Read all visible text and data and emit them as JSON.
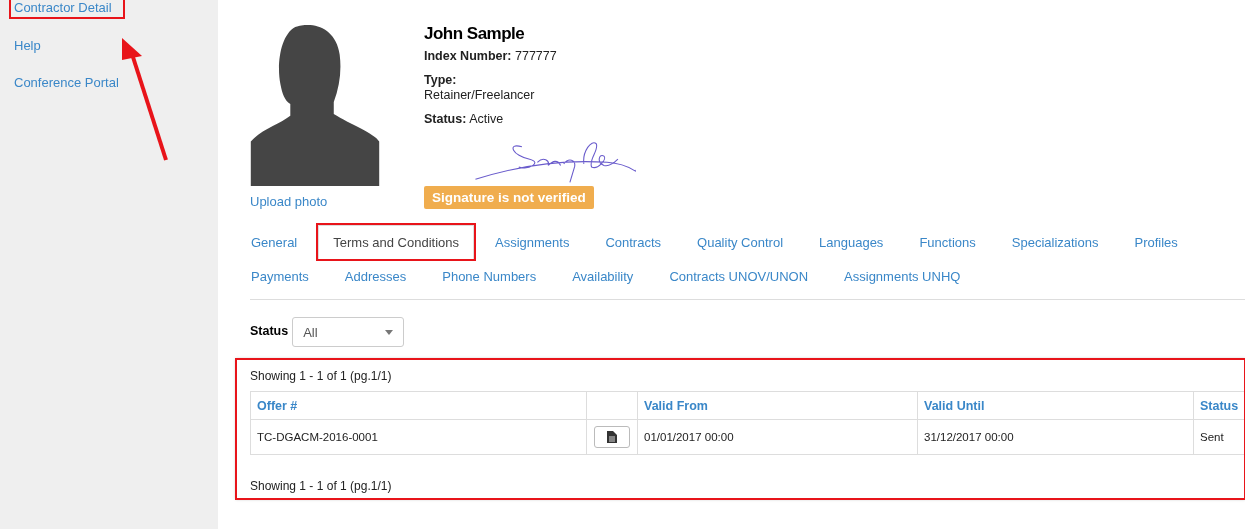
{
  "sidebar": {
    "items": [
      {
        "label": "Contractor Detail",
        "highlighted": true
      },
      {
        "label": "Help",
        "highlighted": false
      },
      {
        "label": "Conference Portal",
        "highlighted": false
      }
    ]
  },
  "profile": {
    "name": "John Sample",
    "upload_link": "Upload photo",
    "fields": [
      {
        "label": "Index Number:",
        "value": "777777",
        "stacked": false
      },
      {
        "label": "Type:",
        "value": "Retainer/Freelancer",
        "stacked": true
      },
      {
        "label": "Status:",
        "value": "Active",
        "stacked": false
      }
    ],
    "signature_badge": "Signature is not verified"
  },
  "tabs": [
    {
      "label": "General",
      "selected": false,
      "highlighted": false
    },
    {
      "label": "Terms and Conditions",
      "selected": true,
      "highlighted": true
    },
    {
      "label": "Assignments",
      "selected": false,
      "highlighted": false
    },
    {
      "label": "Contracts",
      "selected": false,
      "highlighted": false
    },
    {
      "label": "Quality Control",
      "selected": false,
      "highlighted": false
    },
    {
      "label": "Languages",
      "selected": false,
      "highlighted": false
    },
    {
      "label": "Functions",
      "selected": false,
      "highlighted": false
    },
    {
      "label": "Specializations",
      "selected": false,
      "highlighted": false
    },
    {
      "label": "Profiles",
      "selected": false,
      "highlighted": false
    },
    {
      "label": "Payments",
      "selected": false,
      "highlighted": false
    },
    {
      "label": "Addresses",
      "selected": false,
      "highlighted": false
    },
    {
      "label": "Phone Numbers",
      "selected": false,
      "highlighted": false
    },
    {
      "label": "Availability",
      "selected": false,
      "highlighted": false
    },
    {
      "label": "Contracts UNOV/UNON",
      "selected": false,
      "highlighted": false
    },
    {
      "label": "Assignments UNHQ",
      "selected": false,
      "highlighted": false
    }
  ],
  "filter": {
    "label": "Status",
    "value": "All"
  },
  "table": {
    "highlighted": true,
    "summary_top": "Showing 1 - 1 of 1 (pg.1/1)",
    "summary_bottom": "Showing 1 - 1 of 1 (pg.1/1)",
    "columns": [
      "Offer #",
      "",
      "Valid From",
      "Valid Until",
      "Status"
    ],
    "rows": [
      {
        "offer": "TC-DGACM-2016-0001",
        "valid_from": "01/01/2017 00:00",
        "valid_until": "31/12/2017 00:00",
        "status": "Sent"
      }
    ]
  }
}
